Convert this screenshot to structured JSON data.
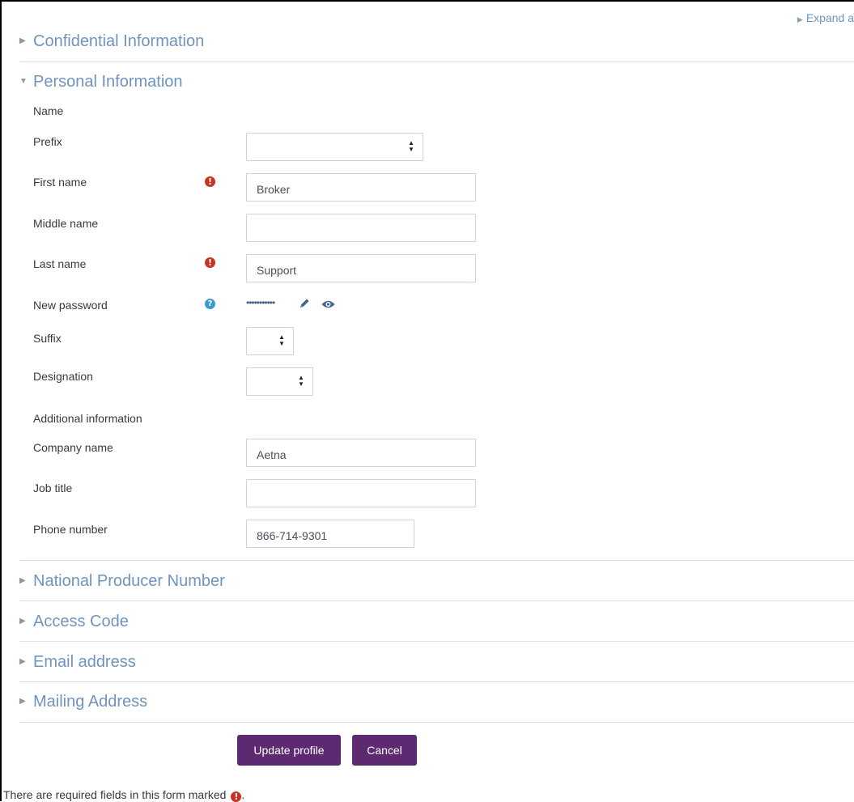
{
  "expand_all": {
    "label": "Expand a"
  },
  "sections": {
    "confidential": "Confidential Information",
    "personal": "Personal Information",
    "npn": "National Producer Number",
    "access_code": "Access Code",
    "email": "Email address",
    "mailing": "Mailing Address"
  },
  "personal": {
    "name_group": "Name",
    "additional_group": "Additional information",
    "prefix": {
      "label": "Prefix",
      "value": ""
    },
    "first_name": {
      "label": "First name",
      "value": "Broker"
    },
    "middle_name": {
      "label": "Middle name",
      "value": ""
    },
    "last_name": {
      "label": "Last name",
      "value": "Support"
    },
    "new_password": {
      "label": "New password",
      "mask": "•••••••••••"
    },
    "suffix": {
      "label": "Suffix",
      "value": ""
    },
    "designation": {
      "label": "Designation",
      "value": ""
    },
    "company_name": {
      "label": "Company name",
      "value": "Aetna"
    },
    "job_title": {
      "label": "Job title",
      "value": ""
    },
    "phone_number": {
      "label": "Phone number",
      "value": "866-714-9301"
    }
  },
  "actions": {
    "update": "Update profile",
    "cancel": "Cancel"
  },
  "footer": {
    "note": "There are required fields in this form marked",
    "end": "."
  },
  "colors": {
    "accent_button": "#5d2a72",
    "required": "#ca3120",
    "help": "#3a9ad6",
    "section_link": "#6f94bd"
  }
}
